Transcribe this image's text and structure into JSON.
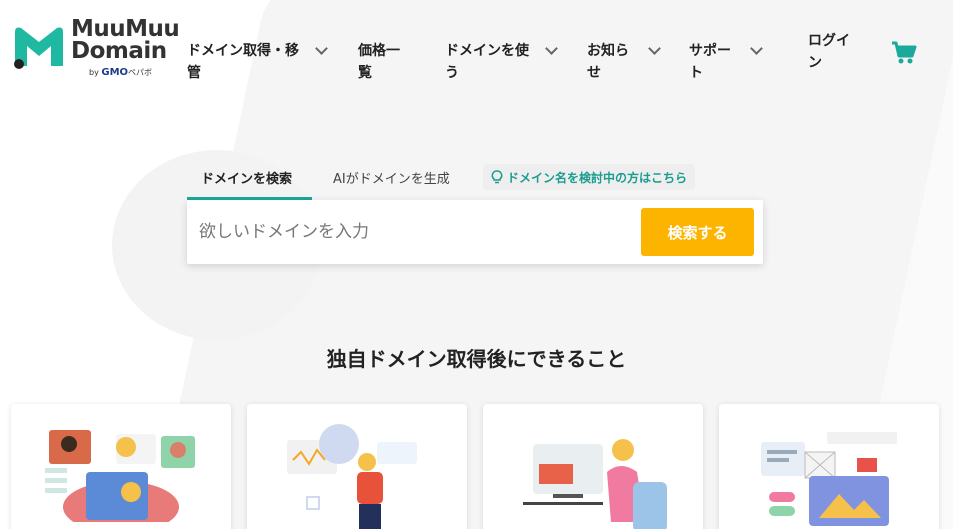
{
  "logo": {
    "line1": "MuuMuu",
    "line2": "Domain",
    "sub_by": "by",
    "sub_brand": "GMO",
    "sub_name": "ペパボ"
  },
  "nav": {
    "items": [
      {
        "line1": "ドメイン取得・移",
        "line2": "管"
      },
      {
        "line1": "価格一",
        "line2": "覧"
      },
      {
        "line1": "ドメインを使",
        "line2": "う"
      },
      {
        "line1": "お知ら",
        "line2": "せ"
      },
      {
        "line1": "サポー",
        "line2": "ト"
      },
      {
        "line1": "ログイ",
        "line2": "ン"
      }
    ],
    "cart_icon": "cart-icon"
  },
  "search": {
    "tab_search": "ドメインを検索",
    "tab_ai": "AIがドメインを生成",
    "hint": "ドメイン名を検討中の方はこちら",
    "placeholder": "欲しいドメインを入力",
    "button": "検索する"
  },
  "section": {
    "title": "独自ドメイン取得後にできること"
  },
  "colors": {
    "accent": "#1aa99a",
    "button": "#fdb400"
  }
}
